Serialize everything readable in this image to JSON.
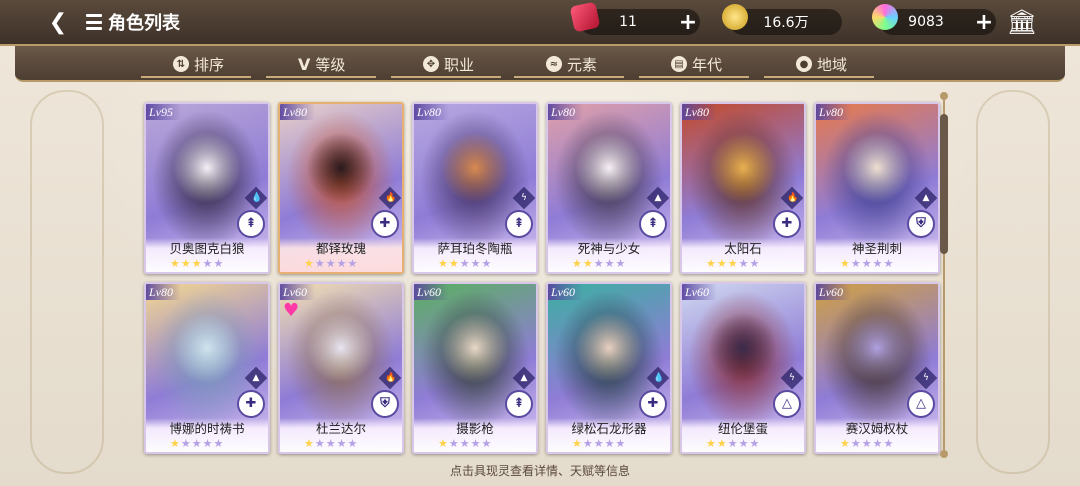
{
  "header": {
    "title": "角色列表",
    "tickets": "11",
    "gold": "16.6万",
    "gems": "9083"
  },
  "filters": [
    "排序",
    "等级",
    "职业",
    "元素",
    "年代",
    "地域"
  ],
  "characters": [
    {
      "name": "贝奥图克白狼",
      "level": "Lv95",
      "stars": 3,
      "element": "water",
      "class": "sword",
      "selected": false,
      "favorite": false,
      "colors": [
        "#2a2135",
        "#b9a7d8",
        "#f4f0f7"
      ]
    },
    {
      "name": "都铎玫瑰",
      "level": "Lv80",
      "stars": 1,
      "element": "fire",
      "class": "cross",
      "selected": true,
      "favorite": false,
      "colors": [
        "#c4522c",
        "#e8d0c8",
        "#2a1a1e"
      ]
    },
    {
      "name": "萨耳珀冬陶瓶",
      "level": "Lv80",
      "stars": 2,
      "element": "thunder",
      "class": "sword",
      "selected": false,
      "favorite": false,
      "colors": [
        "#3a2a5a",
        "#b7a8e0",
        "#d98a50"
      ]
    },
    {
      "name": "死神与少女",
      "level": "Lv80",
      "stars": 2,
      "element": "earth",
      "class": "sword",
      "selected": false,
      "favorite": false,
      "colors": [
        "#3a3040",
        "#e0a0a8",
        "#f7f0f4"
      ]
    },
    {
      "name": "太阳石",
      "level": "Lv80",
      "stars": 3,
      "element": "fire",
      "class": "cross",
      "selected": false,
      "favorite": false,
      "colors": [
        "#5a2a1a",
        "#c34a2a",
        "#e8b050"
      ]
    },
    {
      "name": "神圣荆刺",
      "level": "Lv80",
      "stars": 1,
      "element": "earth",
      "class": "shield",
      "selected": false,
      "favorite": false,
      "colors": [
        "#3a3a8a",
        "#e87a4a",
        "#f0e0d0"
      ]
    },
    {
      "name": "博娜的时祷书",
      "level": "Lv80",
      "stars": 1,
      "element": "earth",
      "class": "cross",
      "selected": false,
      "favorite": false,
      "colors": [
        "#7a9ab8",
        "#f4d890",
        "#cfe3ee"
      ]
    },
    {
      "name": "杜兰达尔",
      "level": "Lv60",
      "stars": 1,
      "element": "fire",
      "class": "shield",
      "selected": false,
      "favorite": true,
      "colors": [
        "#8a6a4a",
        "#f3e0b0",
        "#e8e4f0"
      ]
    },
    {
      "name": "摄影枪",
      "level": "Lv60",
      "stars": 1,
      "element": "earth",
      "class": "sword",
      "selected": false,
      "favorite": false,
      "colors": [
        "#2a3a2a",
        "#5ab060",
        "#e8d8c8"
      ]
    },
    {
      "name": "绿松石龙形器",
      "level": "Lv60",
      "stars": 1,
      "element": "water",
      "class": "cross",
      "selected": false,
      "favorite": false,
      "colors": [
        "#1a3a3a",
        "#3ab0a0",
        "#e8d0c0"
      ]
    },
    {
      "name": "纽伦堡蛋",
      "level": "Lv60",
      "stars": 2,
      "element": "thunder",
      "class": "triangle",
      "selected": false,
      "favorite": false,
      "colors": [
        "#8a2a2a",
        "#d0d8f0",
        "#3a2a4a"
      ]
    },
    {
      "name": "赛汉姆权杖",
      "level": "Lv60",
      "stars": 1,
      "element": "thunder",
      "class": "triangle",
      "selected": false,
      "favorite": false,
      "colors": [
        "#3a2a1a",
        "#d0a040",
        "#b0a0e0"
      ]
    }
  ],
  "hint": "点击具现灵查看详情、天赋等信息",
  "colors": {
    "accent": "#b89a6a",
    "bar": "#4d3e32"
  }
}
